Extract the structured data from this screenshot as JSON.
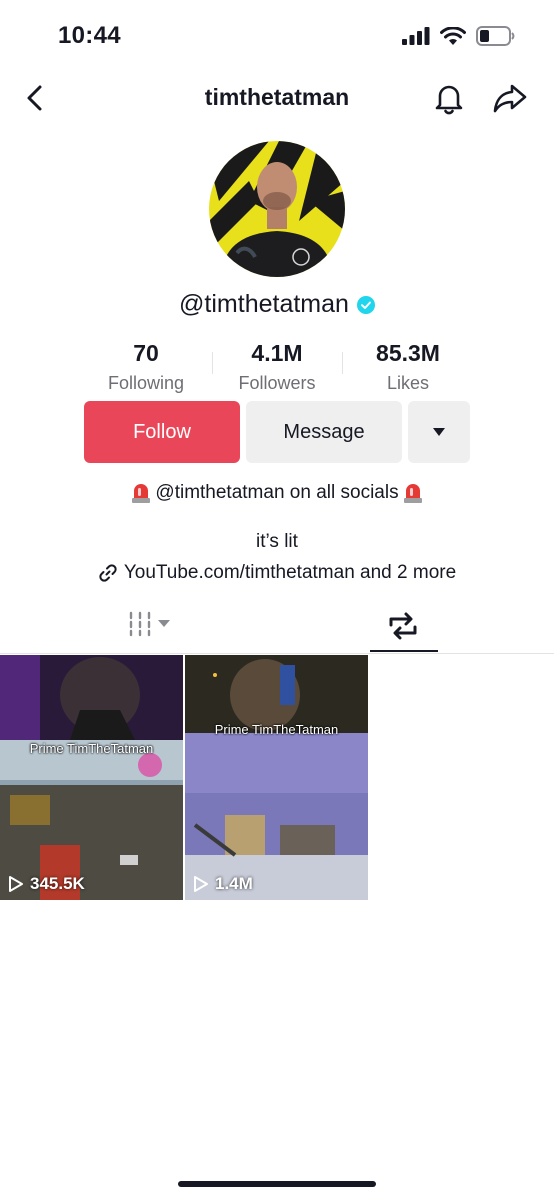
{
  "status_bar": {
    "time": "10:44"
  },
  "header": {
    "title": "timthetatman"
  },
  "profile": {
    "handle": "@timthetatman",
    "verified": true,
    "stats": [
      {
        "value": "70",
        "label": "Following"
      },
      {
        "value": "4.1M",
        "label": "Followers"
      },
      {
        "value": "85.3M",
        "label": "Likes"
      }
    ]
  },
  "actions": {
    "follow_label": "Follow",
    "message_label": "Message"
  },
  "bio": {
    "line1": "@timthetatman on all socials",
    "line2": "it’s lit",
    "link": "YouTube.com/timthetatman and 2 more"
  },
  "videos": [
    {
      "title": "Prime TimTheTatman",
      "views": "345.5K"
    },
    {
      "title": "Prime TimTheTatman",
      "views": "1.4M"
    }
  ],
  "colors": {
    "accent": "#ea4659",
    "verified": "#20d5ec"
  }
}
